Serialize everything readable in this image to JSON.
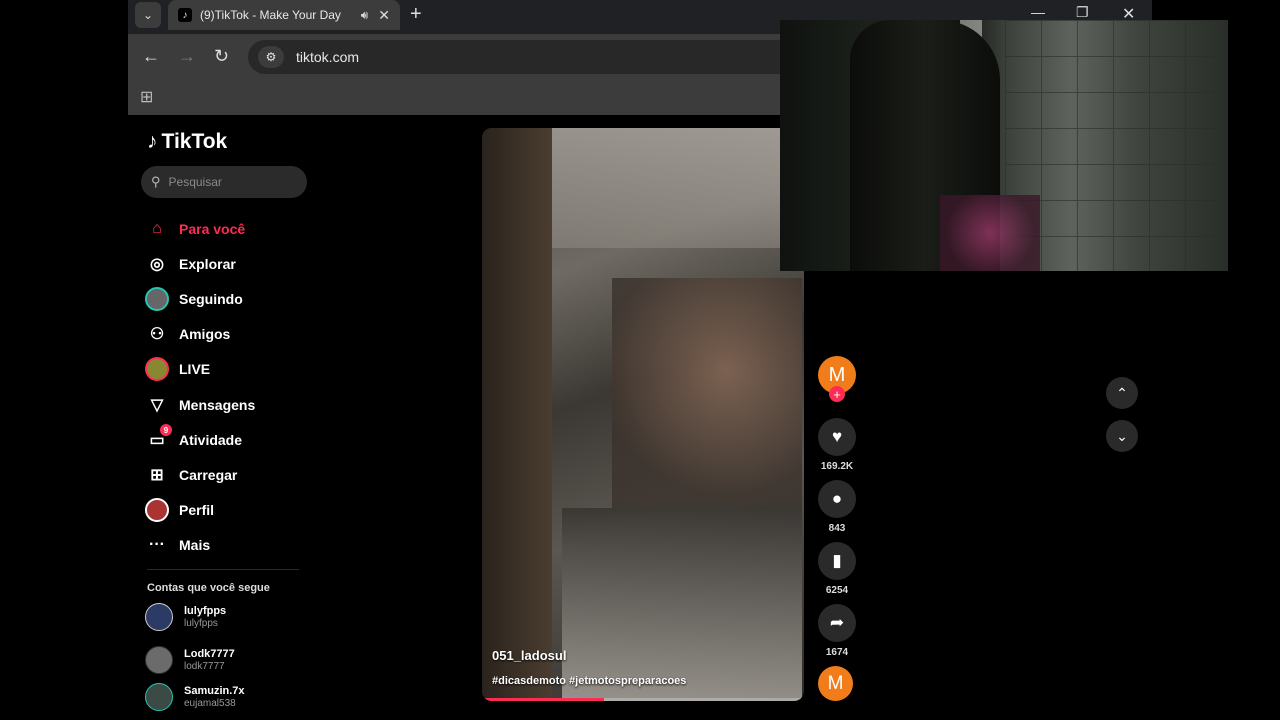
{
  "browser": {
    "tab_title": "(9)TikTok - Make Your Day",
    "url": "tiktok.com"
  },
  "sidebar": {
    "logo": "TikTok",
    "search_placeholder": "Pesquisar",
    "menu": [
      {
        "label": "Para você",
        "icon": "home-icon",
        "active": true
      },
      {
        "label": "Explorar",
        "icon": "compass-icon"
      },
      {
        "label": "Seguindo",
        "icon": "avatar-icon"
      },
      {
        "label": "Amigos",
        "icon": "friends-icon"
      },
      {
        "label": "LIVE",
        "icon": "live-avatar-icon"
      },
      {
        "label": "Mensagens",
        "icon": "send-icon"
      },
      {
        "label": "Atividade",
        "icon": "inbox-icon",
        "badge": "9"
      },
      {
        "label": "Carregar",
        "icon": "upload-icon"
      },
      {
        "label": "Perfil",
        "icon": "profile-avatar-icon"
      },
      {
        "label": "Mais",
        "icon": "more-icon"
      }
    ],
    "following_header": "Contas que você segue",
    "following": [
      {
        "name": "lulyfpps",
        "handle": "lulyfpps"
      },
      {
        "name": "Lodk7777",
        "handle": "lodk7777"
      },
      {
        "name": "Samuzin.7x",
        "handle": "eujamal538"
      }
    ]
  },
  "video": {
    "author": "051_ladosul",
    "hashtags": "#dicasdemoto #jetmotospreparacoes",
    "progress": 0.38
  },
  "actions": {
    "author_initial": "M",
    "likes": "169.2K",
    "comments": "843",
    "saves": "6254",
    "shares": "1674",
    "sound_initial": "M"
  },
  "colors": {
    "accent": "#fe2c55",
    "avatar_orange": "#f07d1a"
  }
}
